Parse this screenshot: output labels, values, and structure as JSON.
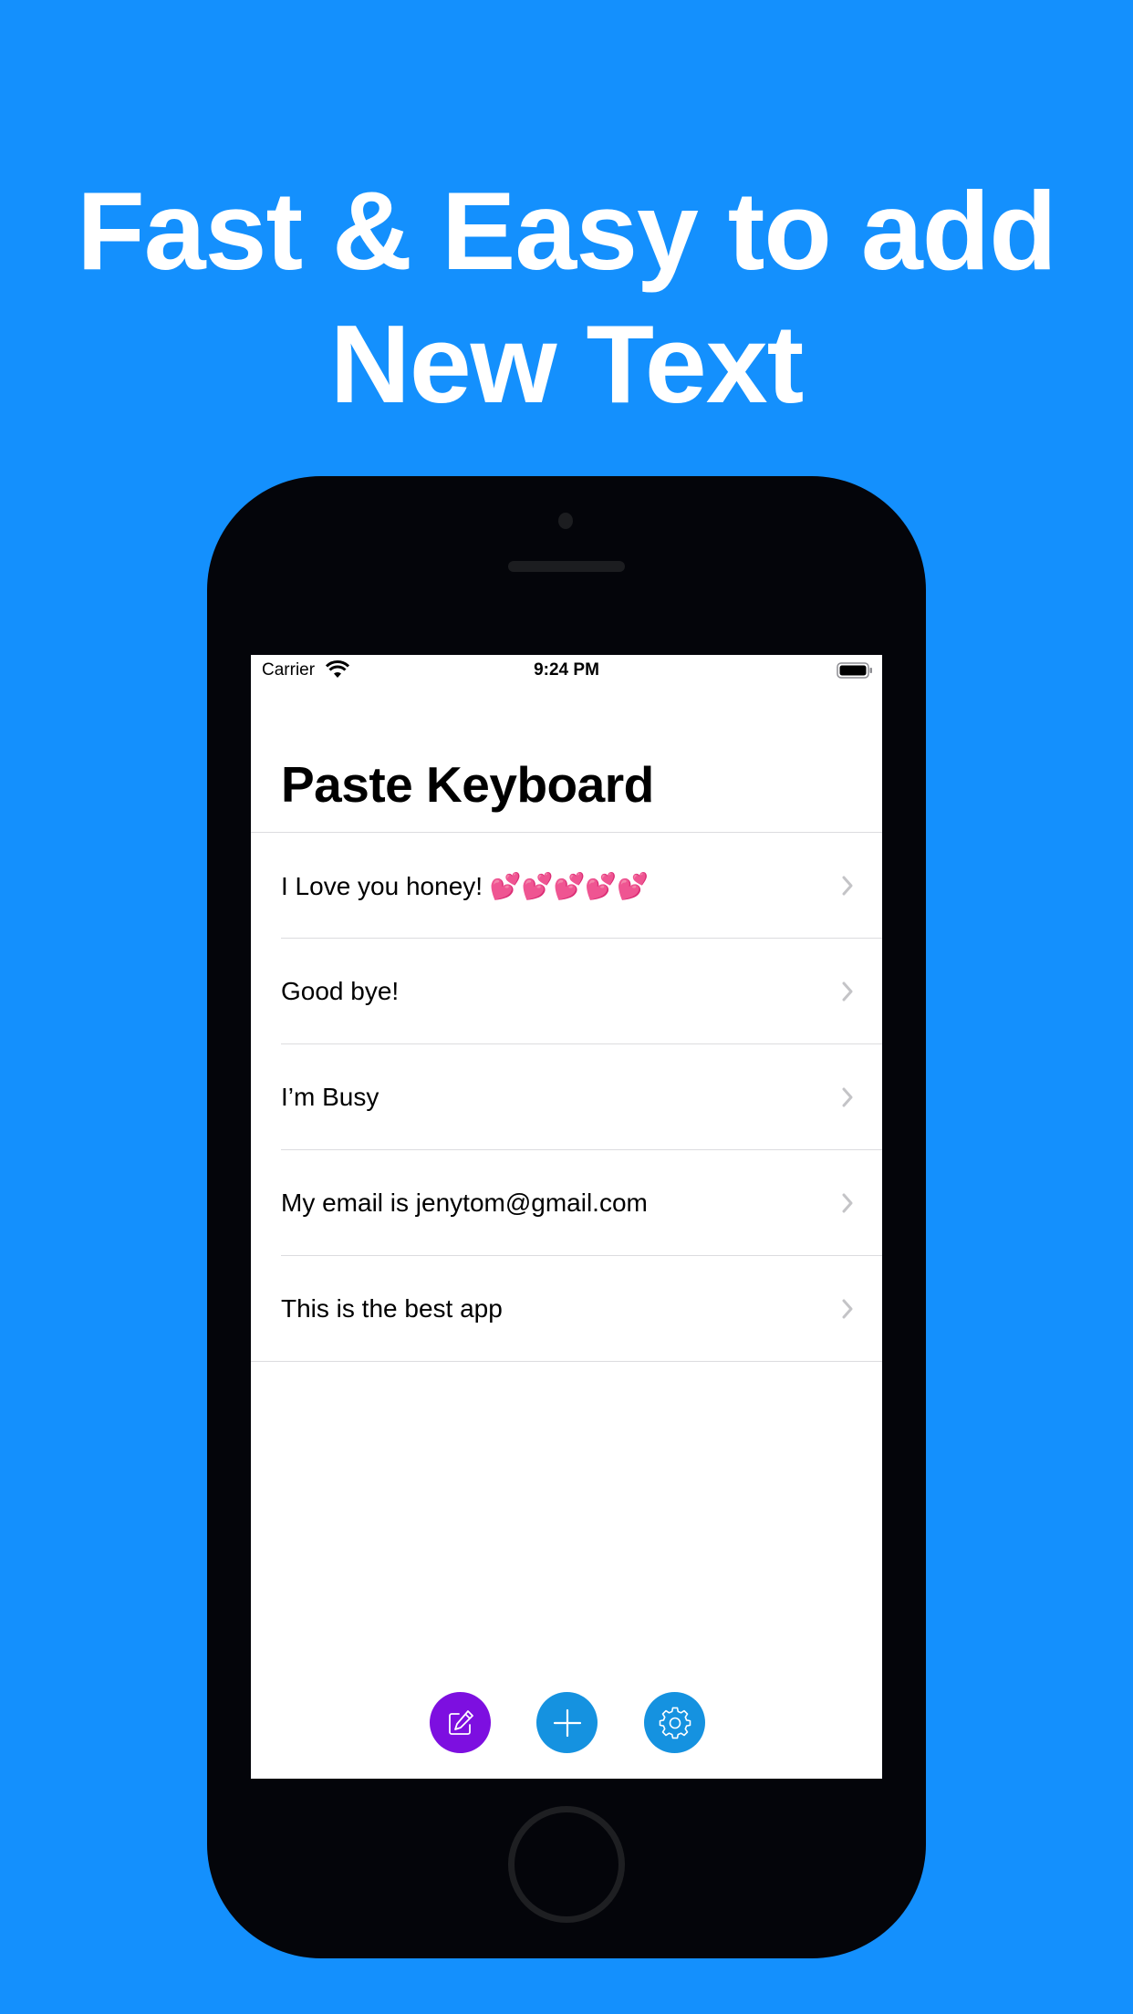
{
  "promo": {
    "headline_line1": "Fast & Easy to add",
    "headline_line2": "New Text",
    "background_color": "#1490fd"
  },
  "status_bar": {
    "carrier": "Carrier",
    "time": "9:24 PM",
    "icons": [
      "wifi-icon",
      "battery-icon"
    ]
  },
  "app": {
    "title": "Paste Keyboard",
    "items": [
      {
        "text": "I Love you honey! 💕💕💕💕💕",
        "icon": "chevron-right-icon"
      },
      {
        "text": "Good bye!",
        "icon": "chevron-right-icon"
      },
      {
        "text": "I’m Busy",
        "icon": "chevron-right-icon"
      },
      {
        "text": "My email is jenytom@gmail.com",
        "icon": "chevron-right-icon"
      },
      {
        "text": "This is the best app",
        "icon": "chevron-right-icon"
      }
    ],
    "toolbar": [
      {
        "action": "edit",
        "icon": "edit-icon",
        "color": "#7d0fe0"
      },
      {
        "action": "add",
        "icon": "plus-icon",
        "color": "#1592e0"
      },
      {
        "action": "settings",
        "icon": "gear-icon",
        "color": "#1592e0"
      }
    ]
  }
}
